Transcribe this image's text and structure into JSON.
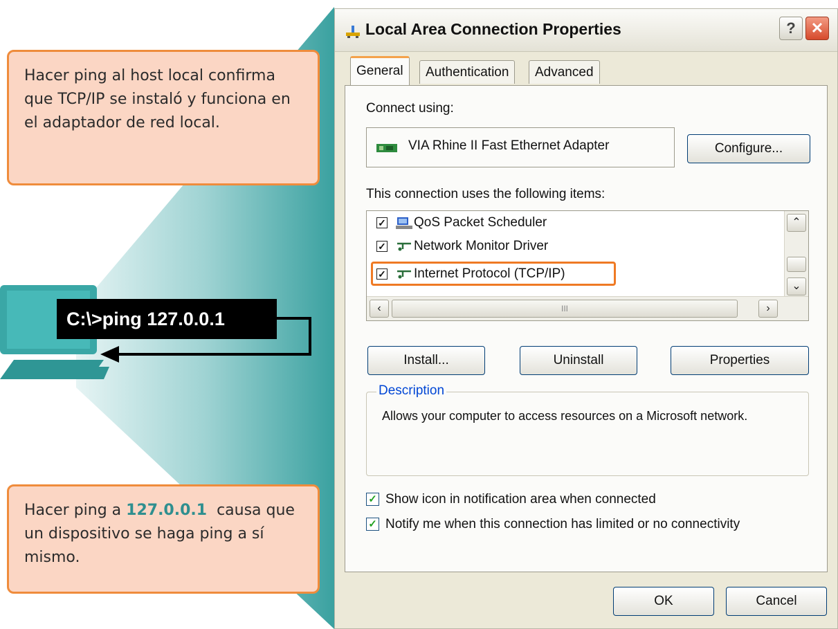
{
  "callouts": {
    "top": "Hacer ping al host local confirma que TCP/IP se instaló y funciona en el adaptador de red local.",
    "bottom_before": "Hacer ping a ",
    "bottom_highlight": "127.0.0.1",
    "bottom_after": "  causa que un dispositivo se haga ping a sí mismo."
  },
  "command": "C:\\>ping 127.0.0.1",
  "dialog": {
    "title": "Local Area Connection Properties",
    "help_label": "?",
    "close_label": "✕",
    "tabs": [
      {
        "label": "General",
        "active": true
      },
      {
        "label": "Authentication",
        "active": false
      },
      {
        "label": "Advanced",
        "active": false
      }
    ],
    "connect_using_label": "Connect using:",
    "adapter_name": "VIA Rhine II Fast Ethernet Adapter",
    "configure_label": "Configure...",
    "items_label": "This connection uses the following items:",
    "items": [
      {
        "label": "QoS Packet Scheduler",
        "checked": true,
        "icon": "qos-scheduler-icon"
      },
      {
        "label": "Network Monitor Driver",
        "checked": true,
        "icon": "network-protocol-icon"
      },
      {
        "label": "Internet Protocol (TCP/IP)",
        "checked": true,
        "icon": "network-protocol-icon",
        "highlighted": true
      }
    ],
    "scroll_thumb_grip": "III",
    "install_label": "Install...",
    "uninstall_label": "Uninstall",
    "properties_label": "Properties",
    "description_label": "Description",
    "description_text": "Allows your computer to access resources on a Microsoft network.",
    "show_icon_label": "Show icon in notification area when connected",
    "show_icon_checked": true,
    "notify_label": "Notify me when this connection has limited or no connectivity",
    "notify_checked": true,
    "ok_label": "OK",
    "cancel_label": "Cancel"
  },
  "colors": {
    "callout_fill": "#fbd6c4",
    "callout_border": "#ef8c3c",
    "teal": "#3aa7a6",
    "highlight": "#ef7a24"
  }
}
